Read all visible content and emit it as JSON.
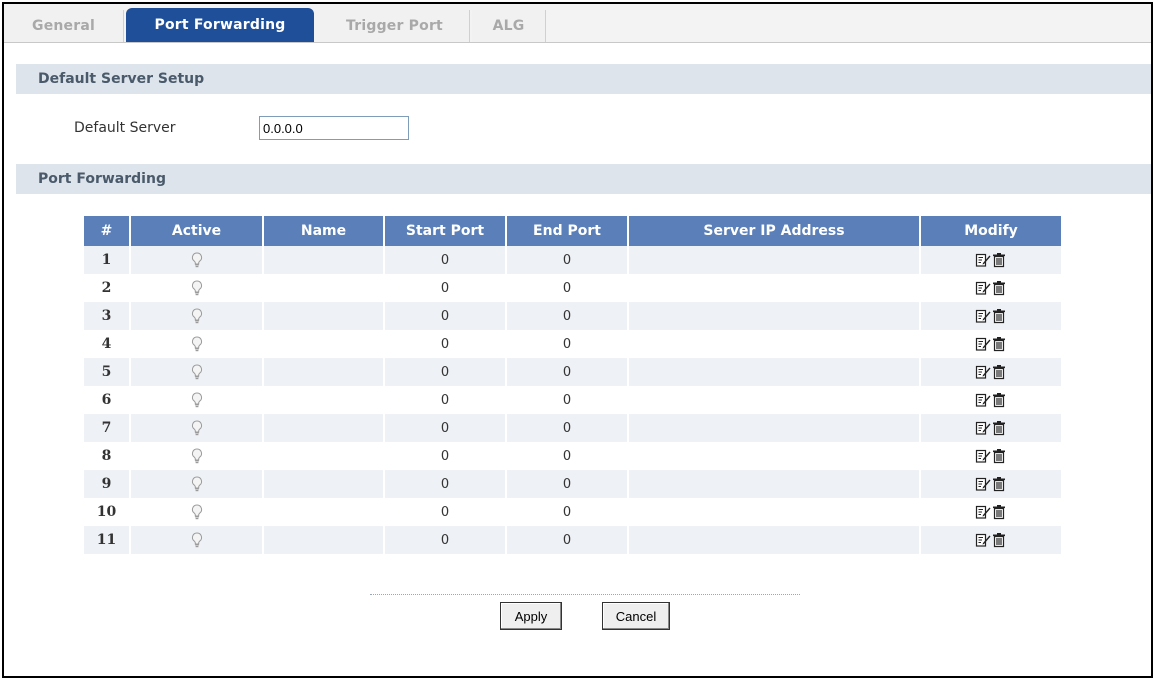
{
  "tabs": [
    {
      "label": "General",
      "active": false
    },
    {
      "label": "Port Forwarding",
      "active": true
    },
    {
      "label": "Trigger Port",
      "active": false
    },
    {
      "label": "ALG",
      "active": false
    }
  ],
  "default_server_section": {
    "title": "Default Server Setup",
    "field_label": "Default Server",
    "field_value": "0.0.0.0"
  },
  "port_forwarding_section": {
    "title": "Port Forwarding",
    "columns": [
      "#",
      "Active",
      "Name",
      "Start Port",
      "End Port",
      "Server IP Address",
      "Modify"
    ],
    "rows": [
      {
        "num": "1",
        "name": "",
        "start": "0",
        "end": "0",
        "ip": ""
      },
      {
        "num": "2",
        "name": "",
        "start": "0",
        "end": "0",
        "ip": ""
      },
      {
        "num": "3",
        "name": "",
        "start": "0",
        "end": "0",
        "ip": ""
      },
      {
        "num": "4",
        "name": "",
        "start": "0",
        "end": "0",
        "ip": ""
      },
      {
        "num": "5",
        "name": "",
        "start": "0",
        "end": "0",
        "ip": ""
      },
      {
        "num": "6",
        "name": "",
        "start": "0",
        "end": "0",
        "ip": ""
      },
      {
        "num": "7",
        "name": "",
        "start": "0",
        "end": "0",
        "ip": ""
      },
      {
        "num": "8",
        "name": "",
        "start": "0",
        "end": "0",
        "ip": ""
      },
      {
        "num": "9",
        "name": "",
        "start": "0",
        "end": "0",
        "ip": ""
      },
      {
        "num": "10",
        "name": "",
        "start": "0",
        "end": "0",
        "ip": ""
      },
      {
        "num": "11",
        "name": "",
        "start": "0",
        "end": "0",
        "ip": ""
      }
    ]
  },
  "buttons": {
    "apply": "Apply",
    "cancel": "Cancel"
  },
  "icons": {
    "active": "lightbulb-icon",
    "edit": "edit-icon",
    "delete": "trash-icon"
  },
  "colors": {
    "active_tab": "#1f4f98",
    "table_header": "#5a7fb9",
    "section_band": "#dde4ec"
  }
}
